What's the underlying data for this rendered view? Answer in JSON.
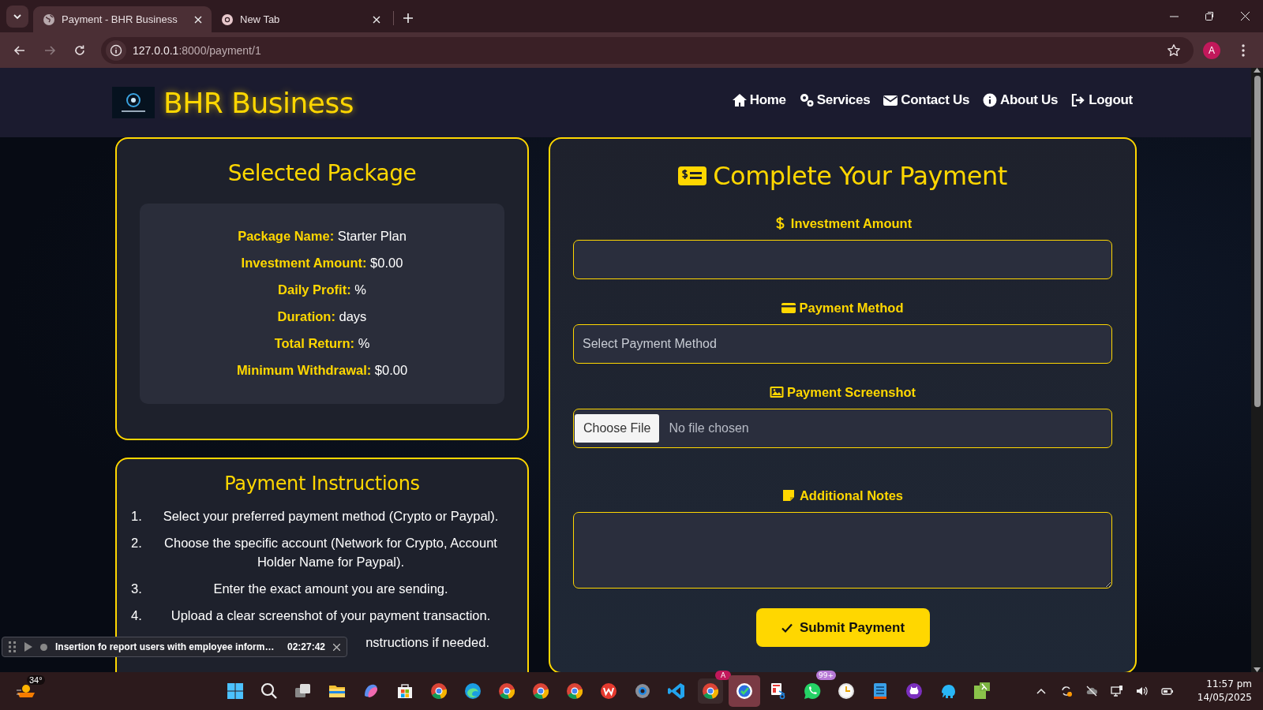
{
  "browser": {
    "tabs": [
      {
        "title": "Payment - BHR Business",
        "selected": true
      },
      {
        "title": "New Tab",
        "selected": false
      }
    ],
    "url_host": "127.0.0.1",
    "url_path": ":8000/payment/1",
    "profile": "A"
  },
  "site": {
    "brand": "BHR Business",
    "nav": [
      {
        "label": "Home"
      },
      {
        "label": "Services"
      },
      {
        "label": "Contact Us"
      },
      {
        "label": "About Us"
      },
      {
        "label": "Logout"
      }
    ]
  },
  "package": {
    "title": "Selected Package",
    "fields": [
      {
        "label": "Package Name:",
        "value": "Starter Plan"
      },
      {
        "label": "Investment Amount:",
        "value": "$0.00"
      },
      {
        "label": "Daily Profit:",
        "value": "%"
      },
      {
        "label": "Duration:",
        "value": "days"
      },
      {
        "label": "Total Return:",
        "value": "%"
      },
      {
        "label": "Minimum Withdrawal:",
        "value": "$0.00"
      }
    ]
  },
  "instructions": {
    "title": "Payment Instructions",
    "steps": [
      {
        "number": "1.",
        "text": "Select your preferred payment method (Crypto or Paypal)."
      },
      {
        "number": "2.",
        "text": "Choose the specific account (Network for Crypto, Account Holder Name for Paypal)."
      },
      {
        "number": "3.",
        "text": "Enter the exact amount you are sending."
      },
      {
        "number": "4.",
        "text": "Upload a clear screenshot of your payment transaction."
      },
      {
        "text": "nstructions if needed."
      }
    ]
  },
  "payment_form": {
    "title": "Complete Your Payment",
    "fields": [
      {
        "kind": "text",
        "label": "Investment Amount"
      },
      {
        "kind": "select",
        "label": "Payment Method",
        "placeholder": "Select Payment Method"
      },
      {
        "kind": "file",
        "label": "Payment Screenshot",
        "button": "Choose File",
        "status": "No file chosen"
      },
      {
        "kind": "textarea",
        "label": "Additional Notes"
      }
    ],
    "submit": "Submit Payment"
  },
  "recording": {
    "title": "Insertion fo report users with employee inform…",
    "time": "02:27:42"
  },
  "taskbar": {
    "temperature": "34°",
    "chrome_profile": "A",
    "whatsapp_badge": "99+",
    "time": "11:57 pm",
    "date": "14/05/2025"
  }
}
